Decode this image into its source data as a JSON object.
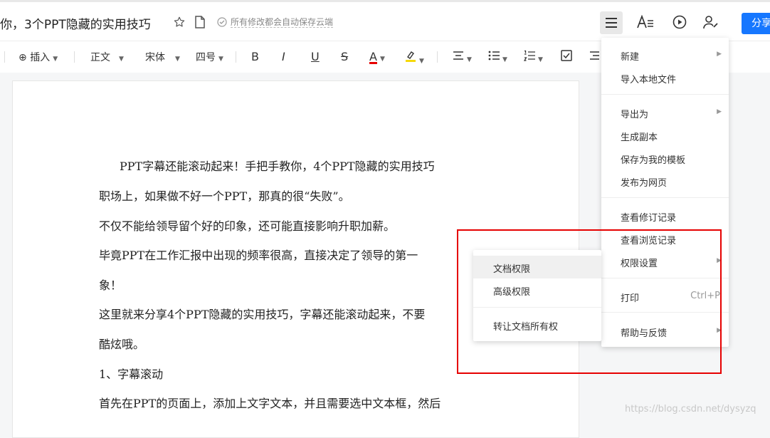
{
  "header": {
    "doc_title": "你，3个PPT隐藏的实用技巧",
    "save_status": "所有修改都会自动保存云端",
    "share_label": "分享"
  },
  "toolbar": {
    "insert": "插入",
    "paragraph_style": "正文",
    "font": "宋体",
    "font_size": "四号",
    "bold": "B",
    "italic": "I",
    "underline": "U",
    "strike": "S",
    "font_color": "A",
    "font_color_value": "#e60000",
    "highlight_color_value": "#f5d90a"
  },
  "document": {
    "paragraphs": [
      "PPT字幕还能滚动起来！手把手教你，4个PPT隐藏的实用技巧",
      "职场上，如果做不好一个PPT，那真的很“失败”。",
      "不仅不能给领导留个好的印象，还可能直接影响升职加薪。",
      "毕竟PPT在工作汇报中出现的频率很高，直接决定了领导的第一",
      "象！",
      "这里就来分享4个PPT隐藏的实用技巧，字幕还能滚动起来，不要",
      "酷炫哦。",
      "1、字幕滚动",
      "首先在PPT的页面上，添加上文字文本，并且需要选中文本框，然后"
    ]
  },
  "menu": {
    "items": [
      {
        "label": "新建"
      },
      {
        "label": "导入本地文件"
      },
      {
        "label": "导出为"
      },
      {
        "label": "生成副本"
      },
      {
        "label": "保存为我的模板"
      },
      {
        "label": "发布为网页"
      },
      {
        "label": "查看修订记录"
      },
      {
        "label": "查看浏览记录"
      },
      {
        "label": "权限设置"
      },
      {
        "label": "打印",
        "shortcut": "Ctrl+P"
      },
      {
        "label": "帮助与反馈"
      }
    ]
  },
  "submenu": {
    "items": [
      {
        "label": "文档权限"
      },
      {
        "label": "高级权限"
      },
      {
        "label": "转让文档所有权"
      }
    ]
  },
  "watermark": "https://blog.csdn.net/dysyzq",
  "colors": {
    "accent": "#1677ff",
    "highlight_box": "#e60000"
  }
}
